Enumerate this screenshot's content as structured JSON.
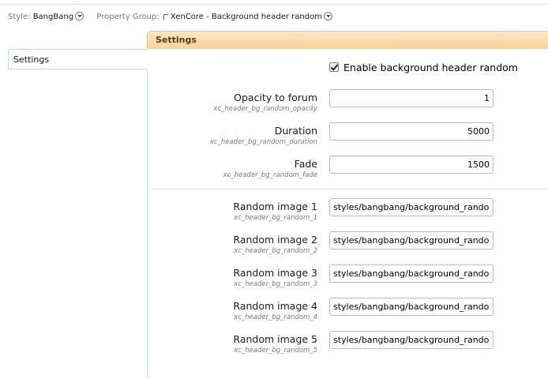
{
  "selector": {
    "style_label": "Style:",
    "style_value": "BangBang",
    "group_label": "Property Group:",
    "group_value": "XenCore - Background header random"
  },
  "header": {
    "title": "Settings"
  },
  "sidebar": {
    "tab_label": "Settings"
  },
  "options": {
    "enable_label": "Enable background header random",
    "enable_checked": true
  },
  "fields": [
    {
      "label": "Opacity to forum",
      "key": "xc_header_bg_random_opacity",
      "value": "1"
    },
    {
      "label": "Duration",
      "key": "xc_header_bg_random_duration",
      "value": "5000"
    },
    {
      "label": "Fade",
      "key": "xc_header_bg_random_fade",
      "value": "1500"
    }
  ],
  "images": [
    {
      "label": "Random image 1",
      "key": "xc_header_bg_random_1",
      "value": "styles/bangbang/background_random"
    },
    {
      "label": "Random image 2",
      "key": "xc_header_bg_random_2",
      "value": "styles/bangbang/background_random"
    },
    {
      "label": "Random image 3",
      "key": "xc_header_bg_random_3",
      "value": "styles/bangbang/background_random"
    },
    {
      "label": "Random image 4",
      "key": "xc_header_bg_random_4",
      "value": "styles/bangbang/background_random"
    },
    {
      "label": "Random image 5",
      "key": "xc_header_bg_random_5",
      "value": "styles/bangbang/background_random"
    }
  ]
}
